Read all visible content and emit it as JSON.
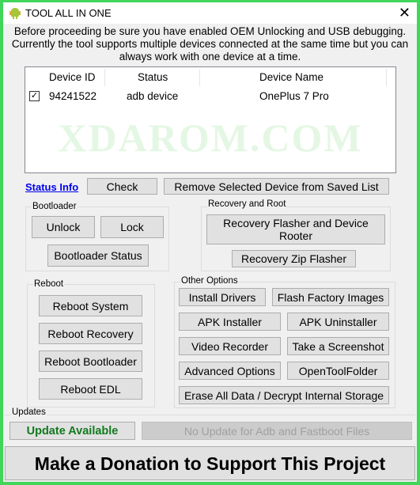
{
  "window": {
    "title": "TOOL ALL IN ONE",
    "icon": "android-icon",
    "close_glyph": "✕"
  },
  "intro_lines": [
    "Before proceeding be sure you have enabled OEM Unlocking and USB debugging.",
    "Currently the tool supports multiple devices connected at the same time but you can",
    "always work with one device at a time."
  ],
  "device_list": {
    "columns": [
      "Device ID",
      "Status",
      "Device Name"
    ],
    "rows": [
      {
        "checked": true,
        "check_glyph": "✓",
        "device_id": "94241522",
        "status": "adb device",
        "device_name": "OnePlus 7 Pro"
      }
    ],
    "watermark": "XDAROM.COM"
  },
  "status_row": {
    "link": "Status Info",
    "check": "Check",
    "remove": "Remove Selected Device from Saved List"
  },
  "bootloader": {
    "label": "Bootloader",
    "unlock": "Unlock",
    "lock": "Lock",
    "status": "Bootloader Status"
  },
  "recovery": {
    "label": "Recovery and Root",
    "flasher_line1": "Recovery Flasher and Device",
    "flasher_line2": "Rooter",
    "zip": "Recovery Zip Flasher"
  },
  "reboot": {
    "label": "Reboot",
    "system": "Reboot System",
    "recovery": "Reboot Recovery",
    "bootloader": "Reboot Bootloader",
    "edl": "Reboot EDL"
  },
  "other": {
    "label": "Other Options",
    "install_drivers": "Install Drivers",
    "flash_factory": "Flash Factory Images",
    "apk_installer": "APK Installer",
    "apk_uninstaller": "APK Uninstaller",
    "video_recorder": "Video Recorder",
    "screenshot": "Take a Screenshot",
    "advanced": "Advanced Options",
    "open_folder": "OpenToolFolder",
    "erase": "Erase All Data / Decrypt Internal Storage"
  },
  "updates": {
    "label": "Updates",
    "available": "Update Available",
    "adb_status": "No Update for Adb and Fastboot Files"
  },
  "donate": "Make a Donation to Support This Project",
  "colors": {
    "frame": "#3fd65a",
    "update_green": "#117a1e",
    "link_blue": "#0000ee"
  }
}
